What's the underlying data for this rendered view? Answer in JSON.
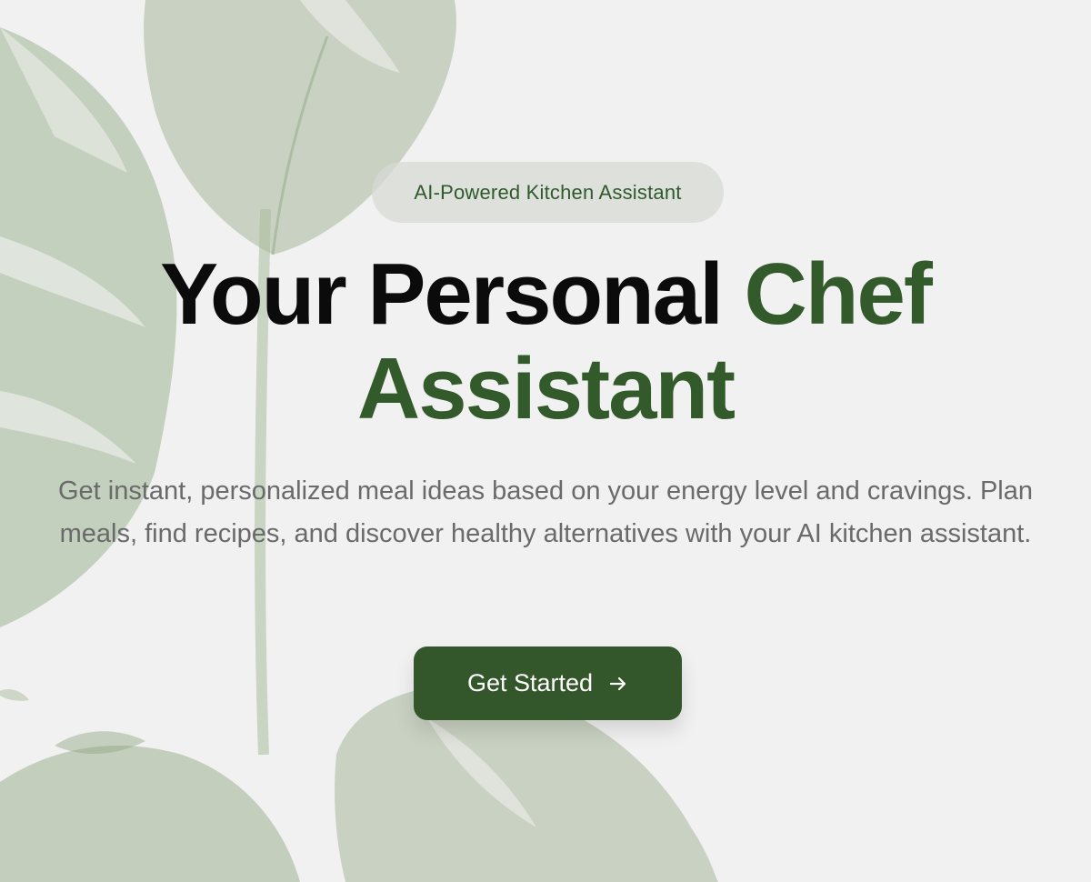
{
  "hero": {
    "badge": "AI-Powered Kitchen Assistant",
    "headline_part1": "Your Personal",
    "headline_accent_line1": "Chef",
    "headline_accent_line2": "Assistant",
    "subtitle": "Get instant, personalized meal ideas based on your energy level and cravings. Plan meals, find recipes, and discover healthy alternatives with your AI kitchen assistant.",
    "cta_label": "Get Started",
    "cta_icon": "arrow-right-icon"
  },
  "colors": {
    "background": "#f2f1f1",
    "accent_green": "#335a2b",
    "button_green": "#33562b",
    "badge_background": "#d6dad4",
    "heading": "#0b0b0b",
    "body_text": "#6a6a6a",
    "leaf": "#9bb08f"
  },
  "background": {
    "image": "monstera-plant"
  }
}
